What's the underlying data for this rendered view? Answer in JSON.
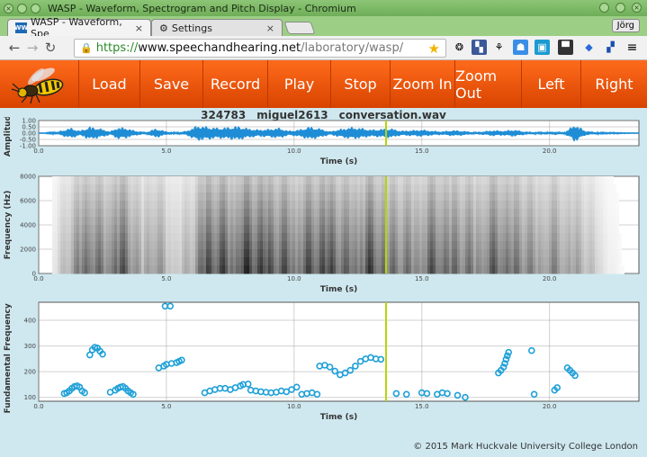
{
  "window": {
    "title": "WASP - Waveform, Spectrogram and Pitch Display - Chromium"
  },
  "tabs": [
    {
      "label": "WASP - Waveform, Spe",
      "active": true
    },
    {
      "label": "Settings",
      "active": false
    }
  ],
  "user": "Jörg",
  "url": {
    "scheme": "https://",
    "host": "www.speechandhearing.net",
    "path": "/laboratory/wasp/"
  },
  "menu": [
    "Load",
    "Save",
    "Record",
    "Play",
    "Stop",
    "Zoom In",
    "Zoom Out",
    "Left",
    "Right"
  ],
  "file_title": "324783__miguel2613__conversation.wav",
  "cursor_time": 13.6,
  "colors": {
    "accent": "#e85c0d",
    "waveform": "#1f8dd6",
    "cursor": "#b5d40a",
    "pitch": "#1ea0d8"
  },
  "footer": "© 2015 Mark Huckvale University College London",
  "chart_data": [
    {
      "type": "line",
      "name": "waveform",
      "xlabel": "Time (s)",
      "ylabel": "Amplitude",
      "xlim": [
        0,
        23.5
      ],
      "ylim": [
        -1,
        1
      ],
      "xticks": [
        "0.0",
        "5.0",
        "10.0",
        "15.0",
        "20.0"
      ],
      "xtick_values": [
        0,
        5,
        10,
        15,
        20
      ],
      "yticks": [
        "1.00",
        "0.50",
        "0.00",
        "-0.50",
        "-1.00"
      ],
      "ytick_values": [
        1,
        0.5,
        0,
        -0.5,
        -1
      ],
      "envelope": {
        "x": [
          0.3,
          0.7,
          1.0,
          1.3,
          1.6,
          2.0,
          2.4,
          2.8,
          3.1,
          3.4,
          3.8,
          4.2,
          4.6,
          5.0,
          5.4,
          5.8,
          6.2,
          6.6,
          7.0,
          7.4,
          7.8,
          8.2,
          8.6,
          9.0,
          9.4,
          9.8,
          10.2,
          10.6,
          11.0,
          11.4,
          11.8,
          12.2,
          12.6,
          13.0,
          13.4,
          13.8,
          14.2,
          14.6,
          15.0,
          15.4,
          15.8,
          16.2,
          16.6,
          17.0,
          17.4,
          17.8,
          18.2,
          18.6,
          19.0,
          19.4,
          19.8,
          20.2,
          20.6,
          21.0,
          21.4,
          21.8,
          22.2,
          22.6,
          23.0,
          23.4
        ],
        "amplitude": [
          0.05,
          0.1,
          0.3,
          0.45,
          0.2,
          0.55,
          0.4,
          0.15,
          0.5,
          0.45,
          0.2,
          0.1,
          0.4,
          0.15,
          0.05,
          0.2,
          0.65,
          0.55,
          0.45,
          0.5,
          0.6,
          0.4,
          0.3,
          0.35,
          0.45,
          0.2,
          0.3,
          0.55,
          0.4,
          0.15,
          0.35,
          0.5,
          0.45,
          0.3,
          0.35,
          0.4,
          0.2,
          0.25,
          0.3,
          0.2,
          0.15,
          0.25,
          0.2,
          0.1,
          0.15,
          0.25,
          0.2,
          0.3,
          0.15,
          0.1,
          0.05,
          0.15,
          0.1,
          0.75,
          0.2,
          0.1,
          0.05,
          0.05,
          0.03,
          0.02
        ]
      }
    },
    {
      "type": "heatmap",
      "name": "spectrogram",
      "xlabel": "Time (s)",
      "ylabel": "Frequency (Hz)",
      "xlim": [
        0,
        23.5
      ],
      "ylim": [
        0,
        8000
      ],
      "xticks": [
        "0.0",
        "5.0",
        "10.0",
        "15.0",
        "20.0"
      ],
      "xtick_values": [
        0,
        5,
        10,
        15,
        20
      ],
      "yticks": [
        "0",
        "2000",
        "4000",
        "6000",
        "8000"
      ],
      "ytick_values": [
        0,
        2000,
        4000,
        6000,
        8000
      ],
      "energy": {
        "x": [
          0.5,
          1.0,
          1.5,
          2.0,
          2.5,
          3.0,
          3.5,
          4.0,
          4.5,
          5.0,
          5.5,
          6.0,
          6.5,
          7.0,
          7.5,
          8.0,
          8.5,
          9.0,
          9.5,
          10.0,
          10.5,
          11.0,
          11.5,
          12.0,
          12.5,
          13.0,
          13.5,
          14.0,
          14.5,
          15.0,
          15.5,
          16.0,
          16.5,
          17.0,
          17.5,
          18.0,
          18.5,
          19.0,
          19.5,
          20.0,
          20.5,
          21.0,
          21.5,
          22.0,
          22.5,
          23.0
        ],
        "level": [
          0.1,
          0.3,
          0.55,
          0.7,
          0.5,
          0.75,
          0.6,
          0.35,
          0.5,
          0.3,
          0.25,
          0.4,
          0.8,
          0.75,
          0.7,
          0.8,
          0.85,
          0.75,
          0.7,
          0.65,
          0.7,
          0.8,
          0.75,
          0.6,
          0.7,
          0.75,
          0.65,
          0.6,
          0.55,
          0.6,
          0.7,
          0.65,
          0.6,
          0.55,
          0.6,
          0.7,
          0.6,
          0.55,
          0.45,
          0.5,
          0.45,
          0.4,
          0.3,
          0.15,
          0.05,
          0.02
        ]
      }
    },
    {
      "type": "scatter",
      "name": "pitch",
      "xlabel": "Time (s)",
      "ylabel": "Fundamental Frequency (H",
      "xlim": [
        0,
        23.5
      ],
      "ylim": [
        85,
        470
      ],
      "xticks": [
        "0.0",
        "5.0",
        "10.0",
        "15.0",
        "20.0"
      ],
      "xtick_values": [
        0,
        5,
        10,
        15,
        20
      ],
      "yticks": [
        "100",
        "200",
        "300",
        "400"
      ],
      "ytick_values": [
        100,
        200,
        300,
        400
      ],
      "points": [
        [
          1.0,
          115
        ],
        [
          1.1,
          118
        ],
        [
          1.2,
          125
        ],
        [
          1.3,
          135
        ],
        [
          1.4,
          142
        ],
        [
          1.5,
          145
        ],
        [
          1.6,
          140
        ],
        [
          1.7,
          125
        ],
        [
          1.8,
          118
        ],
        [
          2.0,
          265
        ],
        [
          2.1,
          285
        ],
        [
          2.2,
          295
        ],
        [
          2.3,
          292
        ],
        [
          2.4,
          280
        ],
        [
          2.5,
          268
        ],
        [
          2.8,
          120
        ],
        [
          3.0,
          128
        ],
        [
          3.1,
          135
        ],
        [
          3.2,
          140
        ],
        [
          3.3,
          142
        ],
        [
          3.4,
          135
        ],
        [
          3.5,
          125
        ],
        [
          3.6,
          118
        ],
        [
          3.7,
          112
        ],
        [
          4.7,
          215
        ],
        [
          4.9,
          222
        ],
        [
          5.0,
          228
        ],
        [
          5.2,
          232
        ],
        [
          5.4,
          235
        ],
        [
          5.5,
          240
        ],
        [
          5.6,
          245
        ],
        [
          4.95,
          455
        ],
        [
          5.15,
          455
        ],
        [
          6.5,
          118
        ],
        [
          6.7,
          125
        ],
        [
          6.9,
          130
        ],
        [
          7.1,
          135
        ],
        [
          7.3,
          135
        ],
        [
          7.5,
          130
        ],
        [
          7.7,
          138
        ],
        [
          7.9,
          145
        ],
        [
          8.0,
          150
        ],
        [
          8.2,
          152
        ],
        [
          8.3,
          128
        ],
        [
          8.5,
          125
        ],
        [
          8.7,
          122
        ],
        [
          8.9,
          120
        ],
        [
          9.1,
          118
        ],
        [
          9.3,
          120
        ],
        [
          9.5,
          125
        ],
        [
          9.7,
          122
        ],
        [
          9.9,
          130
        ],
        [
          10.1,
          140
        ],
        [
          10.3,
          112
        ],
        [
          10.5,
          115
        ],
        [
          10.7,
          118
        ],
        [
          10.9,
          112
        ],
        [
          11.0,
          222
        ],
        [
          11.2,
          225
        ],
        [
          11.4,
          218
        ],
        [
          11.6,
          202
        ],
        [
          11.8,
          188
        ],
        [
          12.0,
          195
        ],
        [
          12.2,
          205
        ],
        [
          12.4,
          222
        ],
        [
          12.6,
          240
        ],
        [
          12.8,
          250
        ],
        [
          13.0,
          255
        ],
        [
          13.2,
          250
        ],
        [
          13.4,
          248
        ],
        [
          14.0,
          115
        ],
        [
          14.4,
          112
        ],
        [
          15.0,
          118
        ],
        [
          15.2,
          115
        ],
        [
          15.6,
          112
        ],
        [
          15.8,
          118
        ],
        [
          16.0,
          115
        ],
        [
          16.4,
          108
        ],
        [
          16.7,
          100
        ],
        [
          18.0,
          195
        ],
        [
          18.1,
          205
        ],
        [
          18.2,
          218
        ],
        [
          18.25,
          232
        ],
        [
          18.3,
          248
        ],
        [
          18.35,
          262
        ],
        [
          18.4,
          275
        ],
        [
          19.3,
          282
        ],
        [
          19.4,
          112
        ],
        [
          20.2,
          128
        ],
        [
          20.3,
          138
        ],
        [
          20.7,
          215
        ],
        [
          20.8,
          205
        ],
        [
          20.9,
          195
        ],
        [
          21.0,
          185
        ]
      ]
    }
  ]
}
